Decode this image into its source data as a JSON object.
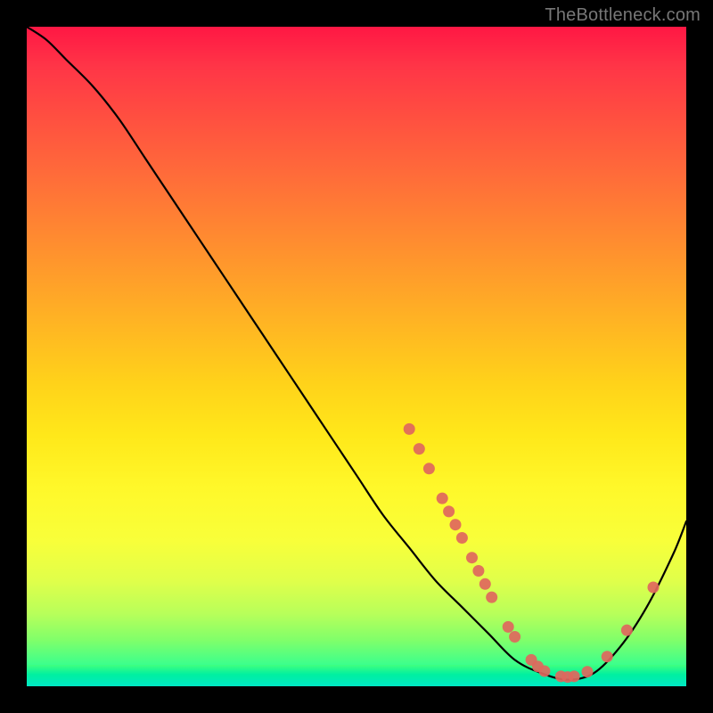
{
  "watermark": "TheBottleneck.com",
  "chart_data": {
    "type": "line",
    "title": "",
    "xlabel": "",
    "ylabel": "",
    "xlim": [
      0,
      100
    ],
    "ylim": [
      0,
      100
    ],
    "grid": false,
    "legend": false,
    "background_gradient": {
      "top": "#ff1744",
      "middle": "#ffe81a",
      "bottom": "#00e8c0"
    },
    "series": [
      {
        "name": "curve",
        "color": "#000000",
        "x": [
          0,
          3,
          6,
          10,
          14,
          18,
          22,
          26,
          30,
          34,
          38,
          42,
          46,
          50,
          54,
          58,
          62,
          66,
          70,
          74,
          78,
          82,
          86,
          90,
          94,
          98,
          100
        ],
        "y": [
          100,
          98,
          95,
          91,
          86,
          80,
          74,
          68,
          62,
          56,
          50,
          44,
          38,
          32,
          26,
          21,
          16,
          12,
          8,
          4,
          2,
          1,
          2,
          6,
          12,
          20,
          25
        ]
      }
    ],
    "markers": {
      "name": "dots",
      "color": "#e0675d",
      "radius": 6.5,
      "points": [
        {
          "x": 58,
          "y": 39
        },
        {
          "x": 59.5,
          "y": 36
        },
        {
          "x": 61,
          "y": 33
        },
        {
          "x": 63,
          "y": 28.5
        },
        {
          "x": 64,
          "y": 26.5
        },
        {
          "x": 65,
          "y": 24.5
        },
        {
          "x": 66,
          "y": 22.5
        },
        {
          "x": 67.5,
          "y": 19.5
        },
        {
          "x": 68.5,
          "y": 17.5
        },
        {
          "x": 69.5,
          "y": 15.5
        },
        {
          "x": 70.5,
          "y": 13.5
        },
        {
          "x": 73,
          "y": 9
        },
        {
          "x": 74,
          "y": 7.5
        },
        {
          "x": 76.5,
          "y": 4
        },
        {
          "x": 77.5,
          "y": 3
        },
        {
          "x": 78.5,
          "y": 2.3
        },
        {
          "x": 81,
          "y": 1.5
        },
        {
          "x": 82,
          "y": 1.4
        },
        {
          "x": 83,
          "y": 1.5
        },
        {
          "x": 85,
          "y": 2.2
        },
        {
          "x": 88,
          "y": 4.5
        },
        {
          "x": 91,
          "y": 8.5
        },
        {
          "x": 95,
          "y": 15
        }
      ]
    }
  }
}
